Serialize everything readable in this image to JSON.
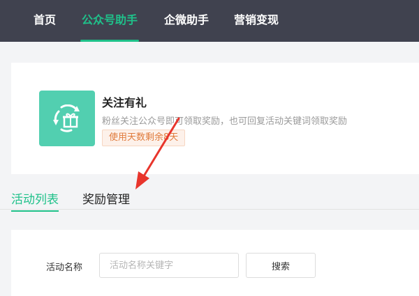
{
  "nav": {
    "items": [
      {
        "label": "首页",
        "active": false
      },
      {
        "label": "公众号助手",
        "active": true
      },
      {
        "label": "企微助手",
        "active": false
      },
      {
        "label": "营销变现",
        "active": false
      }
    ]
  },
  "app": {
    "title": "关注有礼",
    "description": "粉丝关注公众号即可领取奖励，也可回复活动关键词领取奖励",
    "days_badge": "使用天数剩余8天",
    "icon": "gift-cycle-icon",
    "icon_color": "#52cfb0"
  },
  "tabs": [
    {
      "label": "活动列表",
      "active": true
    },
    {
      "label": "奖励管理",
      "active": false
    }
  ],
  "filter": {
    "label": "活动名称",
    "placeholder": "活动名称关键字",
    "value": "",
    "search_label": "搜索"
  },
  "colors": {
    "accent": "#1fc18a",
    "nav_bg": "#40424f",
    "annotation_arrow": "#e8352c"
  }
}
